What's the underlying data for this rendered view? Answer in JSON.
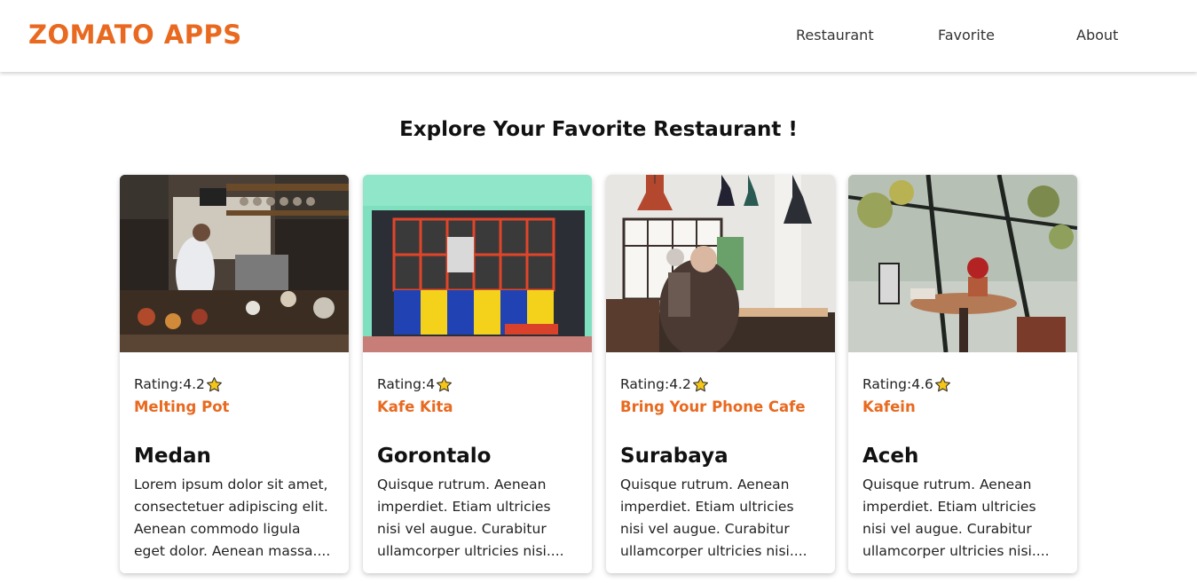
{
  "header": {
    "brand": "ZOMATO APPS",
    "nav": [
      "Restaurant",
      "Favorite",
      "About"
    ]
  },
  "main": {
    "title": "Explore Your Favorite Restaurant !",
    "rating_prefix": "Rating: ",
    "cards": [
      {
        "rating": "4.2",
        "name": "Melting Pot",
        "city": "Medan",
        "description": "Lorem ipsum dolor sit amet, consectetuer adipiscing elit. Aenean commodo ligula eget dolor. Aenean massa...."
      },
      {
        "rating": "4",
        "name": "Kafe Kita",
        "city": "Gorontalo",
        "description": "Quisque rutrum. Aenean imperdiet. Etiam ultricies nisi vel augue. Curabitur ullamcorper ultricies nisi...."
      },
      {
        "rating": "4.2",
        "name": "Bring Your Phone Cafe",
        "city": "Surabaya",
        "description": "Quisque rutrum. Aenean imperdiet. Etiam ultricies nisi vel augue. Curabitur ullamcorper ultricies nisi...."
      },
      {
        "rating": "4.6",
        "name": "Kafein",
        "city": "Aceh",
        "description": "Quisque rutrum. Aenean imperdiet. Etiam ultricies nisi vel augue. Curabitur ullamcorper ultricies nisi...."
      }
    ]
  },
  "colors": {
    "brand": "#e8691f",
    "star": "#f5c518"
  }
}
